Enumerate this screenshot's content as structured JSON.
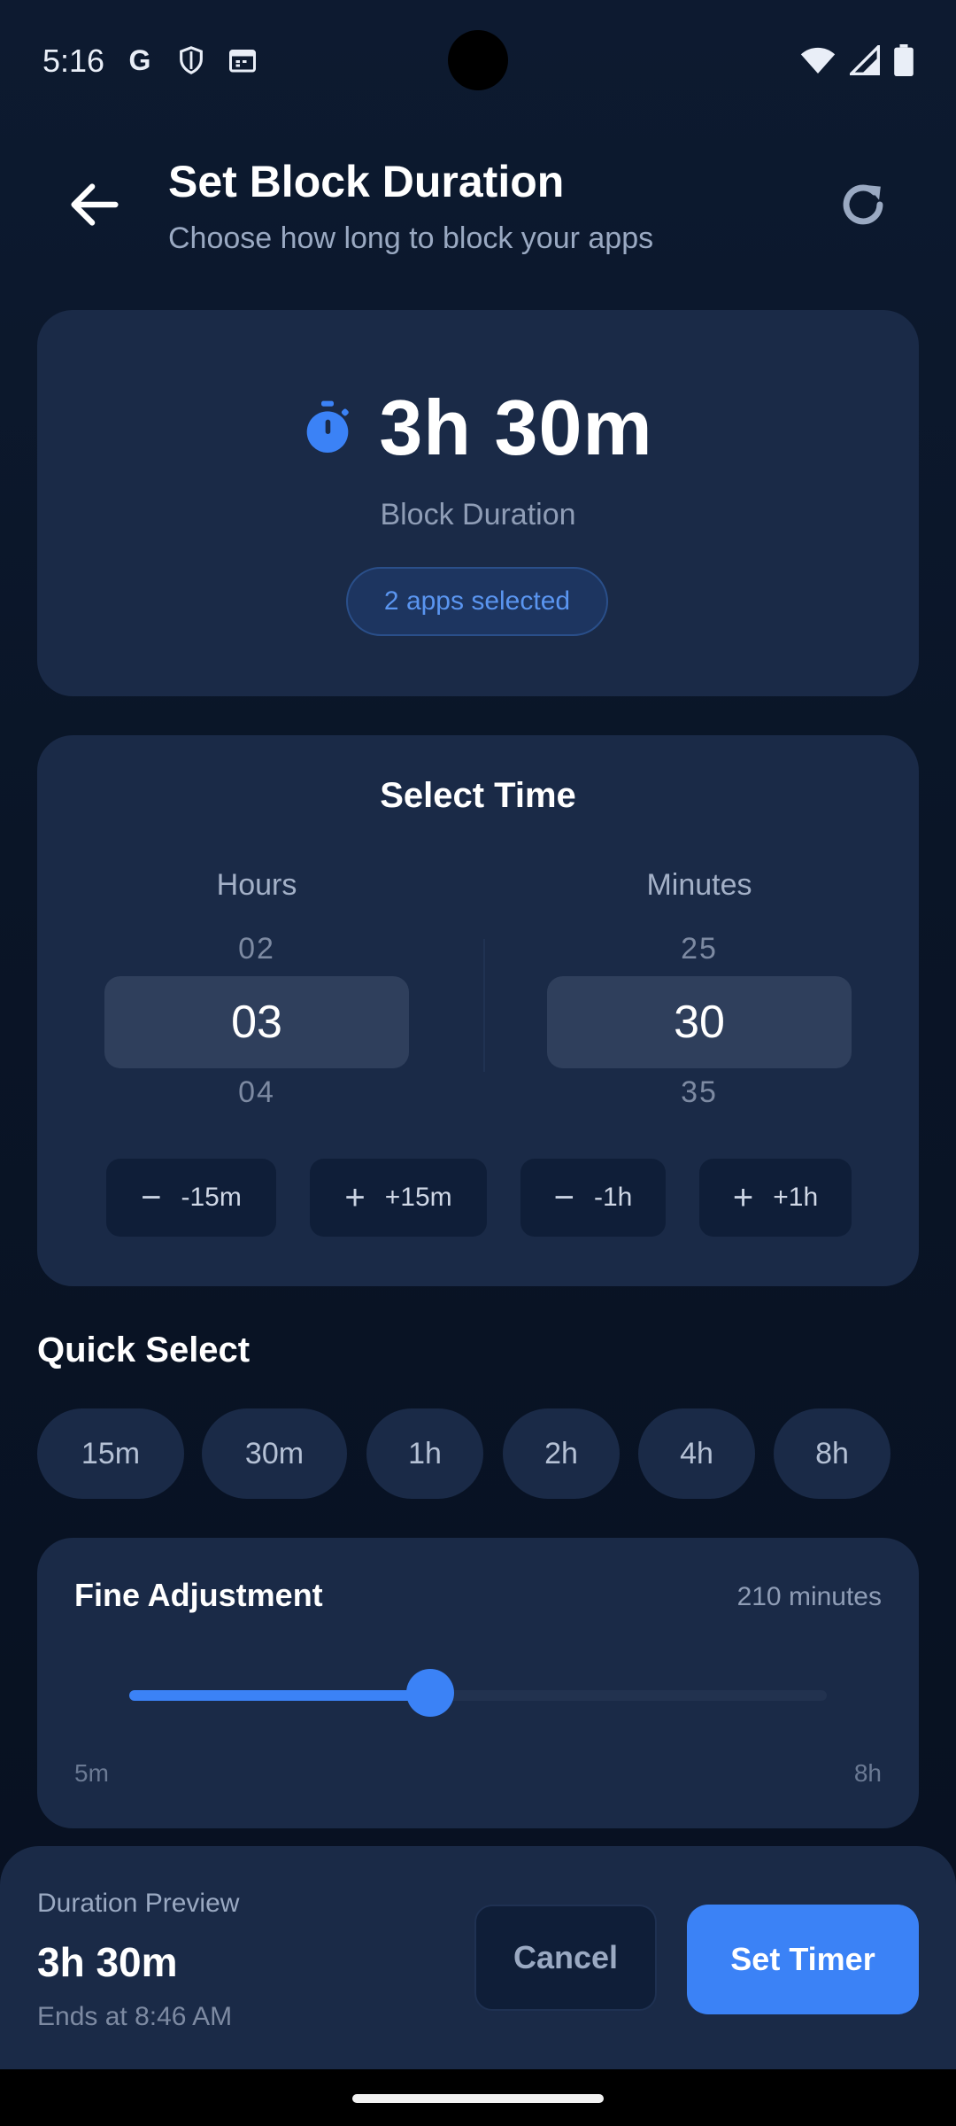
{
  "status_bar": {
    "time": "5:16",
    "icons": [
      "google-icon",
      "shield-icon",
      "calendar-icon",
      "wifi-icon",
      "signal-icon",
      "battery-icon"
    ]
  },
  "header": {
    "title": "Set Block Duration",
    "subtitle": "Choose how long to block your apps"
  },
  "summary": {
    "duration": "3h 30m",
    "label": "Block Duration",
    "apps_badge": "2 apps selected",
    "icon": "timer-icon"
  },
  "select_time": {
    "title": "Select Time",
    "hours": {
      "label": "Hours",
      "prev": "02",
      "selected": "03",
      "next": "04"
    },
    "minutes": {
      "label": "Minutes",
      "prev": "25",
      "selected": "30",
      "next": "35"
    },
    "buttons": [
      {
        "symbol": "−",
        "label": "-15m"
      },
      {
        "symbol": "+",
        "label": "+15m"
      },
      {
        "symbol": "−",
        "label": "-1h"
      },
      {
        "symbol": "+",
        "label": "+1h"
      }
    ]
  },
  "quick_select": {
    "title": "Quick Select",
    "chips": [
      "15m",
      "30m",
      "1h",
      "2h",
      "4h",
      "8h"
    ]
  },
  "fine_adjustment": {
    "title": "Fine Adjustment",
    "value_text": "210 minutes",
    "min_label": "5m",
    "max_label": "8h",
    "min_minutes": 5,
    "max_minutes": 480,
    "value_minutes": 210
  },
  "preview": {
    "label": "Duration Preview",
    "value": "3h 30m",
    "ends": "Ends at 8:46 AM"
  },
  "actions": {
    "cancel": "Cancel",
    "set_timer": "Set Timer"
  },
  "colors": {
    "accent": "#3b82f6",
    "card": "#1a2a47",
    "background": "#0b1628"
  }
}
